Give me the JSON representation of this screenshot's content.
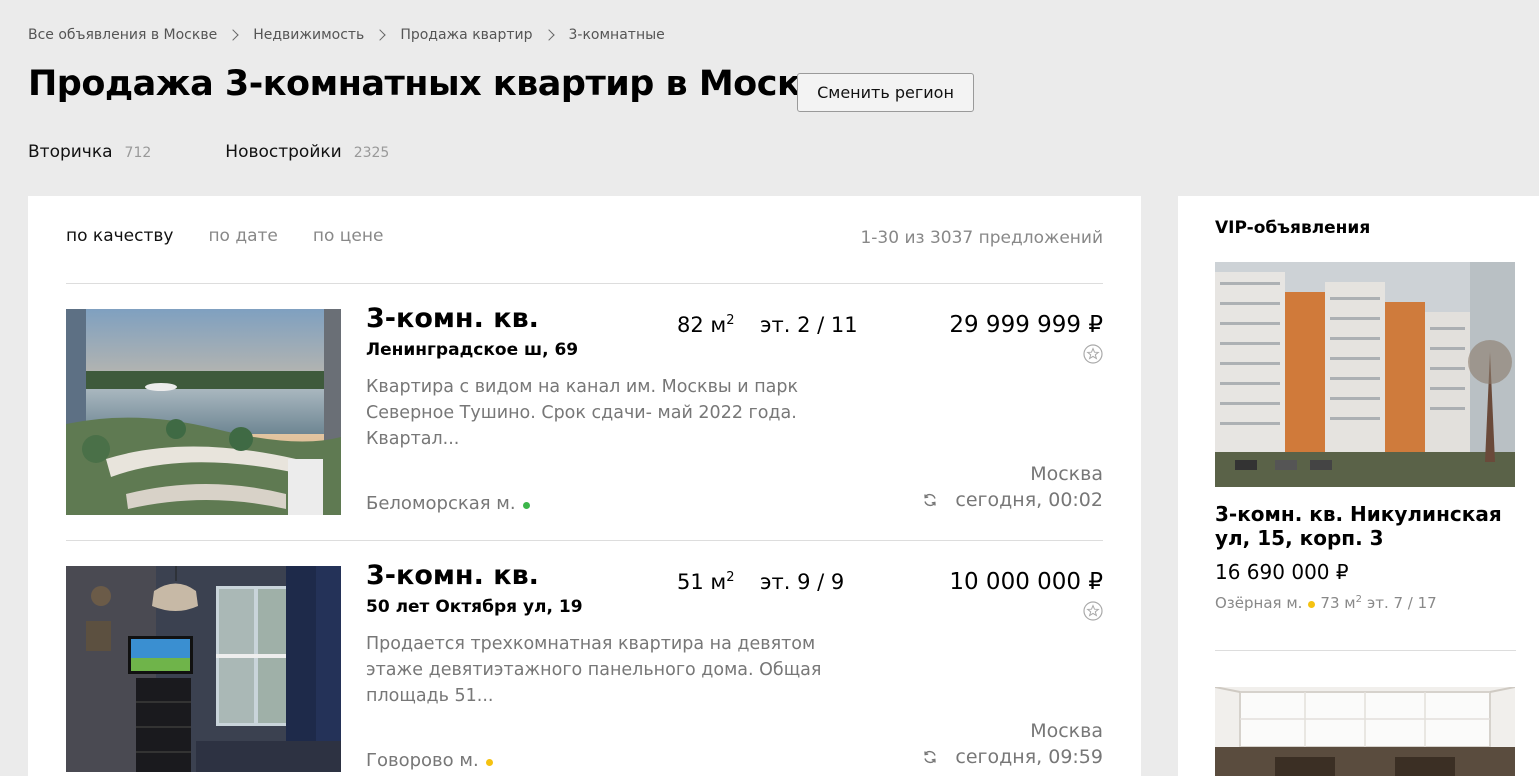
{
  "breadcrumbs": [
    "Все объявления в Москве",
    "Недвижимость",
    "Продажа квартир",
    "3-комнатные"
  ],
  "page_title": "Продажа 3-комнатных квартир в Москве",
  "region_button": "Сменить регион",
  "categories": [
    {
      "label": "Вторичка",
      "count": "712"
    },
    {
      "label": "Новостройки",
      "count": "2325"
    }
  ],
  "sort": {
    "options": [
      "по качеству",
      "по дате",
      "по цене"
    ],
    "active": "по качеству"
  },
  "results_count": "1-30 из 3037 предложений",
  "listings": [
    {
      "title": "3-комн. кв.",
      "address": "Ленинградское ш, 69",
      "area_value": "82 м",
      "area_sup": "2",
      "floor": "эт. 2 / 11",
      "price": "29 999 999 ₽",
      "description": "Квартира с видом на канал им. Москвы и парк Северное Тушино. Срок сдачи- май 2022 года. Квартал...",
      "metro": "Беломорская м.",
      "metro_color": "#3cb64a",
      "city": "Москва",
      "date": "сегодня, 00:02"
    },
    {
      "title": "3-комн. кв.",
      "address": "50 лет Октября ул, 19",
      "area_value": "51 м",
      "area_sup": "2",
      "floor": "эт. 9 / 9",
      "price": "10 000 000 ₽",
      "description": "Продается трехкомнатная квартира на девятом этаже девятиэтажного панельного дома. Общая площадь 51...",
      "metro": "Говорово м.",
      "metro_color": "#f5c211",
      "city": "Москва",
      "date": "сегодня, 09:59"
    }
  ],
  "vip": {
    "title": "VIP-объявления",
    "items": [
      {
        "title": "3-комн. кв. Никулинская ул, 15, корп. 3",
        "price": "16 690 000 ₽",
        "metro": "Озёрная м.",
        "metro_color": "#f5c211",
        "area_value": "73 м",
        "area_sup": "2",
        "floor": "эт. 7 / 17"
      }
    ]
  },
  "icons": {
    "breadcrumb_separator": "chevron-right-icon",
    "favorite": "star-icon",
    "refresh": "refresh-icon"
  }
}
